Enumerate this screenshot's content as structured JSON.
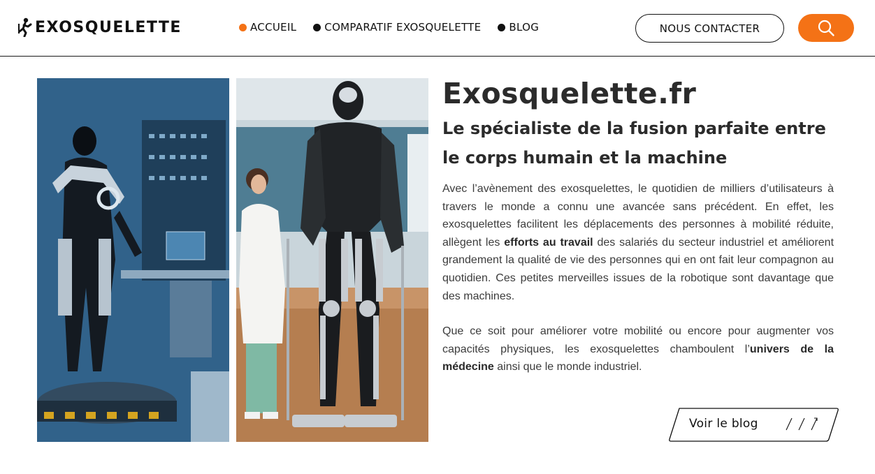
{
  "header": {
    "logo_text": "EXOSQUELETTE",
    "nav": [
      {
        "label": "ACCUEIL",
        "active": true
      },
      {
        "label": "COMPARATIF EXOSQUELETTE",
        "active": false
      },
      {
        "label": "BLOG",
        "active": false
      }
    ],
    "contact_label": "NOUS CONTACTER",
    "search_icon": "search-icon"
  },
  "main": {
    "title": "Exosquelette.fr",
    "subtitle": "Le spécialiste de la fusion parfaite entre le corps humain et la machine",
    "para1": {
      "before": "Avec l’avènement des exosquelettes, le quotidien de milliers d’utilisateurs à travers le monde a connu une avancée sans précédent. En effet, les exosquelettes facilitent les déplacements des personnes à mobilité réduite, allègent les ",
      "bold": "efforts au travail",
      "after": " des salariés du secteur industriel et améliorent grandement la qualité de vie des personnes qui en ont fait leur compagnon au quotidien. Ces petites merveilles issues de la robotique sont davantage que des machines."
    },
    "para2": {
      "before": "Que ce soit pour améliorer votre mobilité ou encore pour augmenter vos capacités physiques, les exosquelettes chamboulent l’",
      "bold": "univers de la médecine",
      "after": " ainsi que le monde industriel."
    },
    "blog_button": "Voir le blog"
  },
  "colors": {
    "accent": "#f47216",
    "text": "#2b2b2b"
  }
}
